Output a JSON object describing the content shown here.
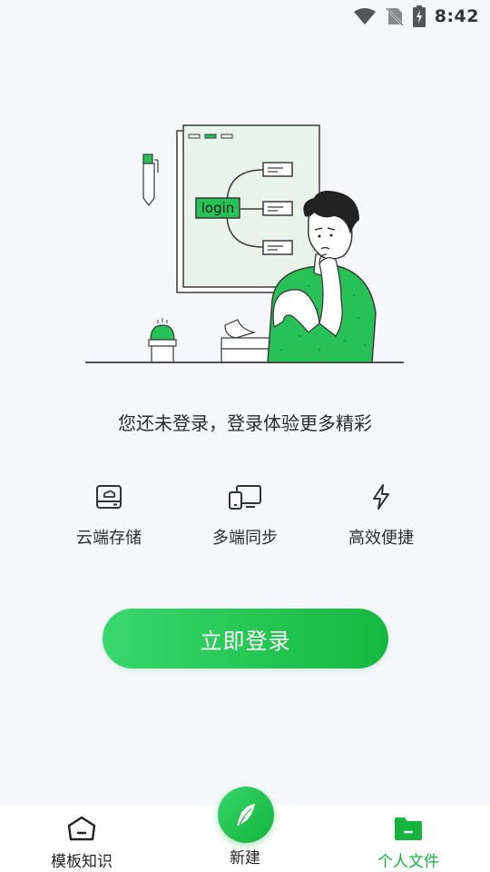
{
  "status_bar": {
    "time": "8:42"
  },
  "illustration": {
    "diagram_label": "login",
    "accent_color": "#27c158",
    "bg_color": "#e8f3ea"
  },
  "prompt": {
    "text": "您还未登录，登录体验更多精彩"
  },
  "features": [
    {
      "label": "云端存储",
      "icon": "cloud-storage-icon"
    },
    {
      "label": "多端同步",
      "icon": "multi-device-sync-icon"
    },
    {
      "label": "高效便捷",
      "icon": "lightning-icon"
    }
  ],
  "login_button": {
    "label": "立即登录"
  },
  "bottom_nav": {
    "items": [
      {
        "label": "模板知识",
        "icon": "home-icon",
        "active": false
      },
      {
        "label": "新建",
        "icon": "feather-icon",
        "active": false
      },
      {
        "label": "个人文件",
        "icon": "folder-icon",
        "active": true
      }
    ]
  },
  "colors": {
    "accent": "#16b43f",
    "background": "#f5f7fb"
  }
}
